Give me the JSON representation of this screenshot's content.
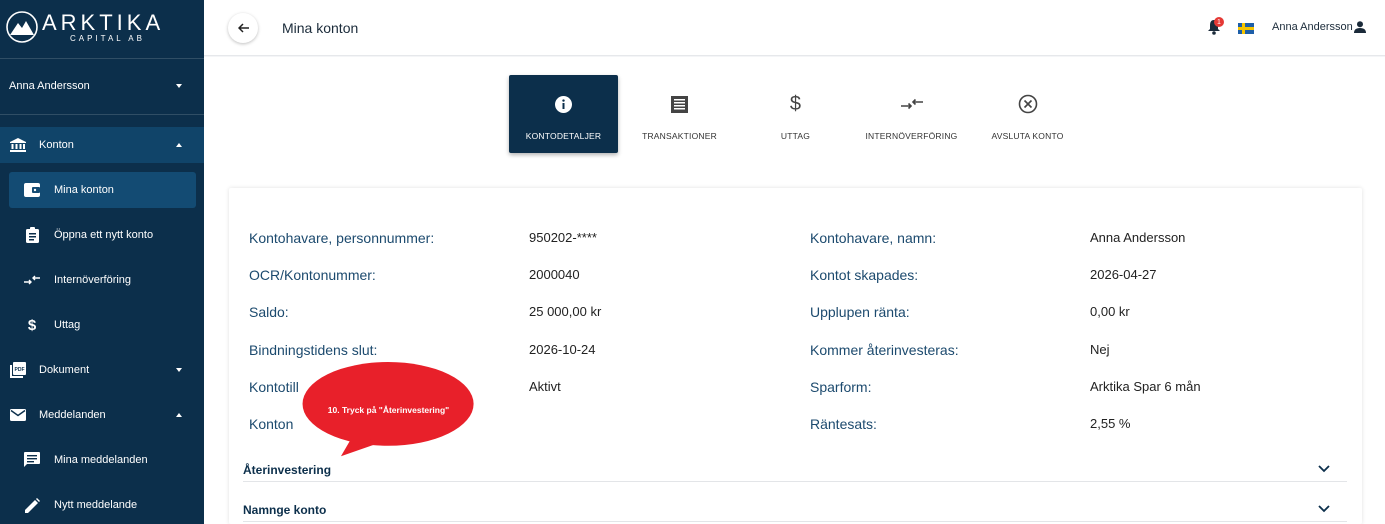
{
  "brand": {
    "name": "ARKTIKA",
    "tagline": "CAPITAL AB"
  },
  "sidebar": {
    "user": "Anna Andersson",
    "items": [
      {
        "label": "Konton",
        "icon": "bank-icon"
      },
      {
        "label": "Mina konton",
        "icon": "wallet-icon"
      },
      {
        "label": "Öppna ett nytt konto",
        "icon": "clipboard-icon"
      },
      {
        "label": "Internöverföring",
        "icon": "transfer-icon"
      },
      {
        "label": "Uttag",
        "icon": "dollar-icon"
      },
      {
        "label": "Dokument",
        "icon": "pdf-icon"
      },
      {
        "label": "Meddelanden",
        "icon": "mail-icon"
      },
      {
        "label": "Mina meddelanden",
        "icon": "chat-icon"
      },
      {
        "label": "Nytt meddelande",
        "icon": "pencil-icon"
      }
    ]
  },
  "header": {
    "title": "Mina konton",
    "notification_count": "1",
    "user": "Anna Andersson"
  },
  "tabs": [
    {
      "label": "KONTODETALJER",
      "icon": "info-icon"
    },
    {
      "label": "TRANSAKTIONER",
      "icon": "receipt-icon"
    },
    {
      "label": "UTTAG",
      "icon": "dollar-icon"
    },
    {
      "label": "INTERNÖVERFÖRING",
      "icon": "transfer-icon"
    },
    {
      "label": "AVSLUTA KONTO",
      "icon": "cancel-icon"
    }
  ],
  "details": {
    "left": [
      {
        "label": "Kontohavare, personnummer:",
        "value": "950202-****"
      },
      {
        "label": "OCR/Kontonummer:",
        "value": "2000040"
      },
      {
        "label": "Saldo:",
        "value": "25 000,00 kr"
      },
      {
        "label": "Bindningstidens slut:",
        "value": "2026-10-24"
      },
      {
        "label": "Kontotill",
        "value": "Aktivt"
      },
      {
        "label": "Konton",
        "value": ""
      }
    ],
    "right": [
      {
        "label": "Kontohavare, namn:",
        "value": "Anna Andersson"
      },
      {
        "label": "Kontot skapades:",
        "value": "2026-04-27"
      },
      {
        "label": "Upplupen ränta:",
        "value": "0,00 kr"
      },
      {
        "label": "Kommer återinvesteras:",
        "value": "Nej"
      },
      {
        "label": "Sparform:",
        "value": "Arktika Spar 6 mån"
      },
      {
        "label": "Räntesats:",
        "value": "2,55 %"
      }
    ]
  },
  "accordions": [
    {
      "title": "Återinvestering"
    },
    {
      "title": "Namnge konto"
    }
  ],
  "callout": {
    "text": "10. Tryck på \"Återinvestering\"",
    "color": "#e8202a"
  }
}
